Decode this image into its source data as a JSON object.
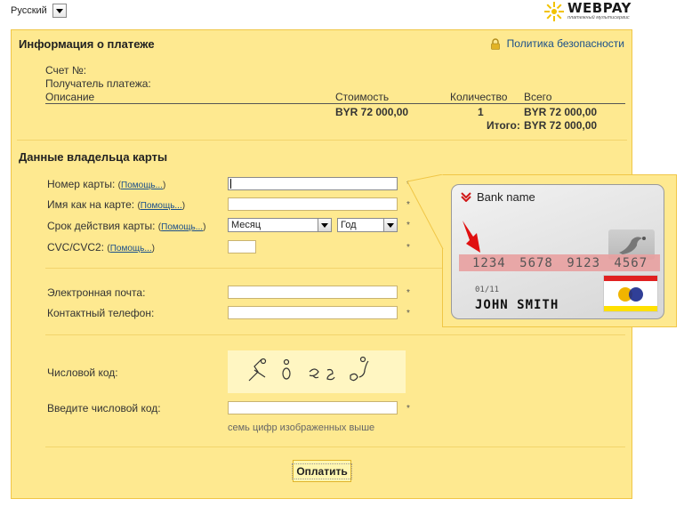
{
  "language": {
    "selected": "Русский"
  },
  "brand": {
    "name": "WEBPAY",
    "tagline": "платежный мультисервис"
  },
  "payment_info": {
    "title": "Информация о платеже",
    "security_link": "Политика безопасности",
    "account_label": "Счет №:",
    "recipient_label": "Получатель платежа:",
    "columns": {
      "description": "Описание",
      "cost": "Стоимость",
      "quantity": "Количество",
      "total": "Всего"
    },
    "row": {
      "cost": "BYR 72 000,00",
      "quantity": "1",
      "total": "BYR 72 000,00"
    },
    "grand_total_label": "Итого:",
    "grand_total_value": "BYR 72 000,00"
  },
  "card_owner": {
    "title": "Данные владельца карты",
    "help_text": "Помощь...",
    "card_number_label": "Номер карты:",
    "card_name_label": "Имя как на карте:",
    "expiry_label": "Срок действия карты:",
    "cvc_label": "CVC/CVC2:",
    "month_placeholder": "Месяц",
    "year_placeholder": "Год",
    "required_mark": "*"
  },
  "contacts": {
    "email_label": "Электронная почта:",
    "phone_label": "Контактный телефон:"
  },
  "captcha": {
    "label": "Числовой код:",
    "input_label": "Введите числовой код:",
    "hint": "семь цифр изображенных выше"
  },
  "submit_label": "Оплатить",
  "sample_card": {
    "bank_name": "Bank name",
    "number": "1234 5678 9123 4567",
    "expiry": "01/11",
    "holder": "JOHN SMITH"
  },
  "colors": {
    "panel_bg": "#fee990",
    "panel_border": "#f0c646",
    "link": "#1a4f8a"
  }
}
